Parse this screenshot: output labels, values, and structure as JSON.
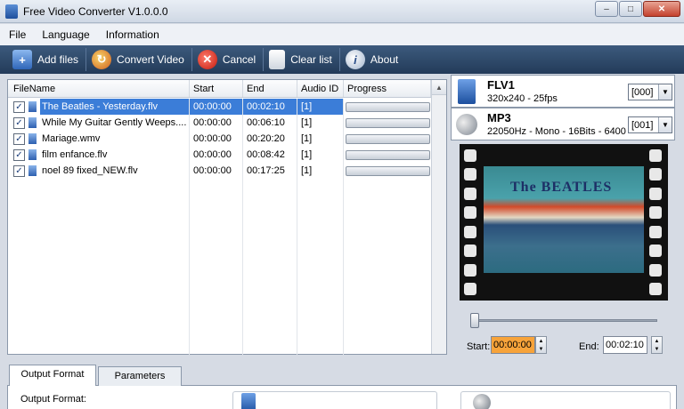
{
  "window": {
    "title": "Free Video Converter V1.0.0.0",
    "minimize": "–",
    "maximize": "□",
    "close": "✕"
  },
  "menu": [
    "File",
    "Language",
    "Information"
  ],
  "toolbar": {
    "add_files": "Add files",
    "convert_video": "Convert Video",
    "cancel": "Cancel",
    "clear_list": "Clear list",
    "about": "About"
  },
  "file_list": {
    "headers": [
      "FileName",
      "Start",
      "End",
      "Audio ID",
      "Progress"
    ],
    "rows": [
      {
        "name": "The Beatles - Yesterday.flv",
        "start": "00:00:00",
        "end": "00:02:10",
        "audio": "[1]",
        "progress": 0,
        "checked": true,
        "selected": true
      },
      {
        "name": "While My Guitar Gently Weeps....",
        "start": "00:00:00",
        "end": "00:06:10",
        "audio": "[1]",
        "progress": 0,
        "checked": true,
        "selected": false
      },
      {
        "name": "Mariage.wmv",
        "start": "00:00:00",
        "end": "00:20:20",
        "audio": "[1]",
        "progress": 0,
        "checked": true,
        "selected": false
      },
      {
        "name": "film enfance.flv",
        "start": "00:00:00",
        "end": "00:08:42",
        "audio": "[1]",
        "progress": 0,
        "checked": true,
        "selected": false
      },
      {
        "name": "noel 89 fixed_NEW.flv",
        "start": "00:00:00",
        "end": "00:17:25",
        "audio": "[1]",
        "progress": 0,
        "checked": true,
        "selected": false
      }
    ]
  },
  "video_format": {
    "title": "FLV1",
    "details": "320x240 - 25fps",
    "select": "[000]",
    "icon": "video-file-icon"
  },
  "audio_format": {
    "title": "MP3",
    "details": "22050Hz - Mono - 16Bits - 6400",
    "select": "[001]",
    "icon": "speaker-icon"
  },
  "preview": {
    "banner": "The BEATLES"
  },
  "trim": {
    "start_label": "Start:",
    "start_value": "00:00:00",
    "end_label": "End:",
    "end_value": "00:02:10"
  },
  "tabs": {
    "output_format": "Output Format",
    "parameters": "Parameters"
  },
  "output": {
    "label": "Output Format:"
  }
}
